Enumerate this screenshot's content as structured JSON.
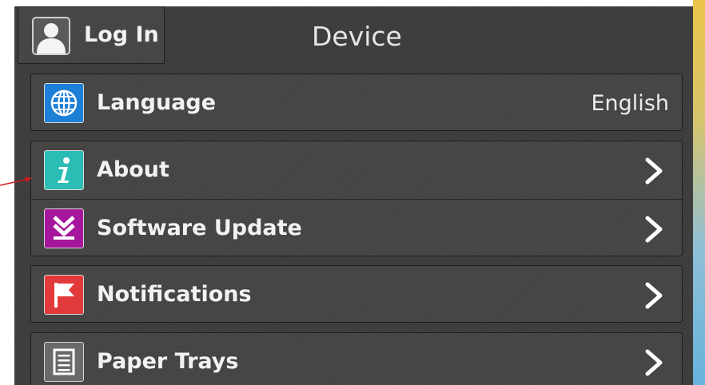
{
  "header": {
    "login_label": "Log In",
    "title": "Device"
  },
  "menu": {
    "language": {
      "label": "Language",
      "value": "English",
      "icon": "globe-icon"
    },
    "about": {
      "label": "About",
      "icon": "info-icon"
    },
    "software_update": {
      "label": "Software Update",
      "icon": "download-icon"
    },
    "notifications": {
      "label": "Notifications",
      "icon": "flag-icon"
    },
    "paper_trays": {
      "label": "Paper Trays",
      "icon": "paper-tray-icon"
    }
  },
  "colors": {
    "panel": "#3c3c3c",
    "globe_bg": "#1e7fd6",
    "info_bg": "#2bbdb5",
    "update_bg": "#a6169c",
    "flag_bg": "#e23a3a",
    "tray_bg": "#6a6a6a",
    "pointer": "#d11a1a"
  }
}
